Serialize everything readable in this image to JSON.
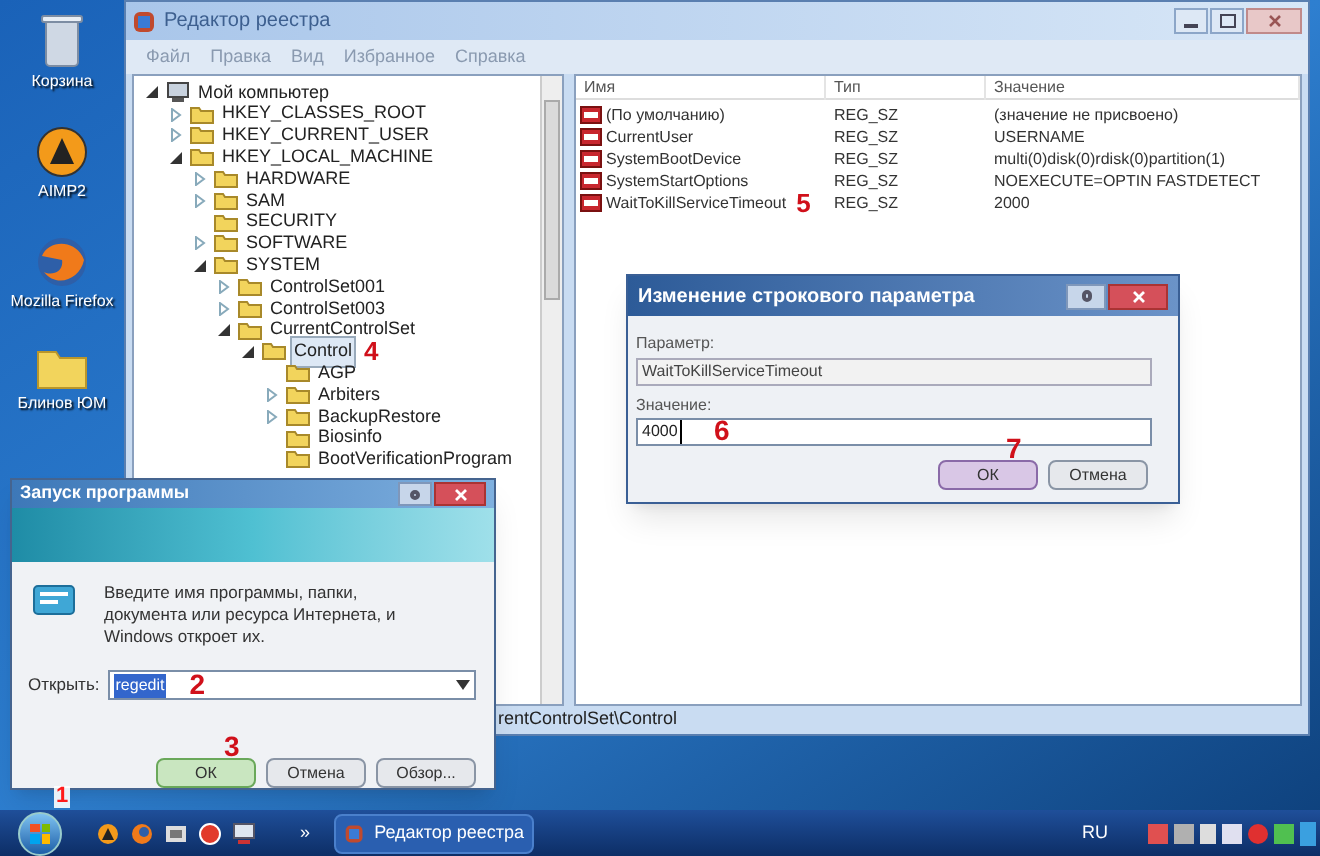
{
  "desktop_icons": [
    {
      "kind": "bin",
      "label": "Корзина"
    },
    {
      "kind": "player",
      "label": "AIMP2"
    },
    {
      "kind": "browser",
      "label": "Mozilla Firefox"
    },
    {
      "kind": "folder",
      "label": "Блинов ЮМ"
    }
  ],
  "regedit": {
    "title": "Редактор реестра",
    "menu": [
      "Файл",
      "Правка",
      "Вид",
      "Избранное",
      "Справка"
    ],
    "tree": [
      {
        "label": "Мой компьютер",
        "kind": "computer",
        "expanded": true,
        "children": [
          {
            "label": "HKEY_CLASSES_ROOT",
            "expanded": false
          },
          {
            "label": "HKEY_CURRENT_USER",
            "expanded": false
          },
          {
            "label": "HKEY_LOCAL_MACHINE",
            "expanded": true,
            "children": [
              {
                "label": "HARDWARE",
                "expanded": false
              },
              {
                "label": "SAM",
                "expanded": false
              },
              {
                "label": "SECURITY"
              },
              {
                "label": "SOFTWARE",
                "expanded": false
              },
              {
                "label": "SYSTEM",
                "expanded": true,
                "children": [
                  {
                    "label": "ControlSet001",
                    "expanded": false
                  },
                  {
                    "label": "ControlSet003",
                    "expanded": false
                  },
                  {
                    "label": "CurrentControlSet",
                    "expanded": true,
                    "children": [
                      {
                        "label": "Control",
                        "expanded": true,
                        "selected": true,
                        "marker": "4",
                        "children": [
                          {
                            "label": "AGP"
                          },
                          {
                            "label": "Arbiters",
                            "expanded": false
                          },
                          {
                            "label": "BackupRestore",
                            "expanded": false
                          },
                          {
                            "label": "Biosinfo"
                          },
                          {
                            "label": "BootVerificationProgram"
                          }
                        ]
                      }
                    ]
                  }
                ]
              }
            ]
          }
        ]
      }
    ],
    "table": {
      "columns": [
        "Имя",
        "Тип",
        "Значение"
      ],
      "rows": [
        {
          "name": "(По умолчанию)",
          "type": "REG_SZ",
          "value": "(значение не присвоено)"
        },
        {
          "name": "CurrentUser",
          "type": "REG_SZ",
          "value": "USERNAME"
        },
        {
          "name": "SystemBootDevice",
          "type": "REG_SZ",
          "value": "multi(0)disk(0)rdisk(0)partition(1)"
        },
        {
          "name": "SystemStartOptions",
          "type": "REG_SZ",
          "value": "NOEXECUTE=OPTIN  FASTDETECT"
        },
        {
          "name": "WaitToKillServiceTimeout",
          "type": "REG_SZ",
          "value": "2000",
          "marker": "5"
        }
      ]
    },
    "status_bar": "rentControlSet\\Control"
  },
  "edit_dialog": {
    "title": "Изменение строкового параметра",
    "name_label": "Параметр:",
    "name_value": "WaitToKillServiceTimeout",
    "value_label": "Значение:",
    "value": "4000",
    "value_marker": "6",
    "buttons": [
      {
        "label": "ОК",
        "default": true,
        "marker": "7"
      },
      {
        "label": "Отмена",
        "default": false
      }
    ]
  },
  "run_dialog": {
    "title": "Запуск программы",
    "text": "Введите имя программы, папки, документа или ресурса Интернета, и Windows откроет их.",
    "open_label": "Открыть:",
    "value": "regedit",
    "value_marker": "2",
    "buttons": [
      {
        "label": "ОК",
        "default": true,
        "marker": "3"
      },
      {
        "label": "Отмена",
        "default": false
      },
      {
        "label": "Обзор...",
        "default": false
      }
    ]
  },
  "taskbar": {
    "start_marker": "1",
    "overflow": "»",
    "task": "Редактор реестра",
    "language": "RU"
  }
}
